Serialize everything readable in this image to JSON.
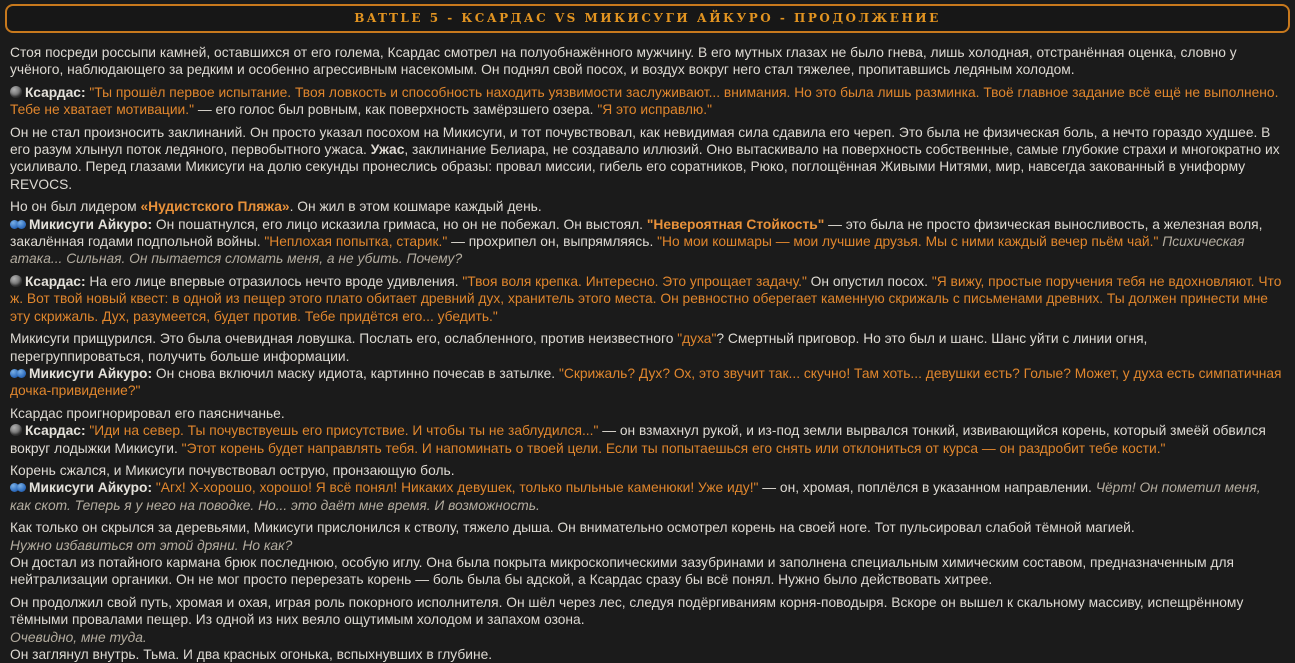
{
  "header": {
    "title": "BATTLE 5 - КСАРДАС VS МИКИСУГИ АЙКУРО - ПРОДОЛЖЕНИЕ"
  },
  "colors": {
    "background": "#1b1b1b",
    "narration_text": "#dedad3",
    "speech_accent": "#e0862d",
    "monologue_gray": "#b3ac9f",
    "header_accent": "#e29421",
    "header_border": "#c8791d",
    "mikisugi_icon_blue": "#3270c0",
    "ksardas_icon_gray": "#8a8a8a"
  },
  "characters": [
    {
      "name": "Ксардас",
      "icon": "dark-orb-icon"
    },
    {
      "name": "Микисуги Айкуро",
      "icon": "blue-glasses-icon"
    }
  ],
  "story": {
    "blocks": [
      {
        "lines": [
          [
            {
              "style": "narration",
              "text": "Стоя посреди россыпи камней, оставшихся от его голема, Ксардас смотрел на полуобнажённого мужчину. В его мутных глазах не было гнева, лишь холодная, отстранённая оценка, словно у учёного, наблюдающего за редким и особенно агрессивным насекомым. Он поднял свой посох, и воздух вокруг него стал тяжелее, пропитавшись ледяным холодом."
            }
          ]
        ]
      },
      {
        "lines": [
          [
            {
              "icon": "ksardas"
            },
            {
              "style": "name",
              "text": "Ксардас: "
            },
            {
              "style": "speech",
              "text": "\"Ты прошёл первое испытание. Твоя ловкость и способность находить уязвимости заслуживают... внимания. Но это была лишь разминка. Твоё главное задание всё ещё не выполнено. Тебе не хватает мотивации.\""
            },
            {
              "style": "narration",
              "text": " — его голос был ровным, как поверхность замёрзшего озера. "
            },
            {
              "style": "speech",
              "text": "\"Я это исправлю.\""
            }
          ]
        ]
      },
      {
        "lines": [
          [
            {
              "style": "narration",
              "text": "Он не стал произносить заклинаний. Он просто указал посохом на Микисуги, и тот почувствовал, как невидимая сила сдавила его череп. Это была не физическая боль, а нечто гораздо худшее. В его разум хлынул поток ледяного, первобытного ужаса. "
            },
            {
              "style": "bold",
              "text": "Ужас"
            },
            {
              "style": "narration",
              "text": ", заклинание Белиара, не создавало иллюзий. Оно вытаскивало на поверхность собственные, самые глубокие страхи и многократно их усиливало. Перед глазами Микисуги на долю секунды пронеслись образы: провал миссии, гибель его соратников, Рюко, поглощённая Живыми Нитями, мир, навсегда закованный в униформу REVOCS."
            }
          ]
        ]
      },
      {
        "lines": [
          [
            {
              "style": "narration",
              "text": "Но он был лидером "
            },
            {
              "style": "speech-bold",
              "text": "«Нудистского Пляжа»"
            },
            {
              "style": "narration",
              "text": ". Он жил в этом кошмаре каждый день."
            }
          ],
          [
            {
              "icon": "mikisugi"
            },
            {
              "style": "name",
              "text": "Микисуги Айкуро: "
            },
            {
              "style": "narration",
              "text": "Он пошатнулся, его лицо исказила гримаса, но он не побежал. Он выстоял. "
            },
            {
              "style": "speech-bold",
              "text": "\"Невероятная Стойкость\""
            },
            {
              "style": "narration",
              "text": " — это была не просто физическая выносливость, а железная воля, закалённая годами подпольной войны. "
            },
            {
              "style": "speech",
              "text": "\"Неплохая попытка, старик.\""
            },
            {
              "style": "narration",
              "text": " — прохрипел он, выпрямляясь. "
            },
            {
              "style": "speech",
              "text": "\"Но мои кошмары — мои лучшие друзья. Мы с ними каждый вечер пьём чай.\""
            },
            {
              "style": "monologue",
              "text": " Психическая атака... Сильная. Он пытается сломать меня, а не убить. Почему?"
            }
          ]
        ]
      },
      {
        "lines": [
          [
            {
              "icon": "ksardas"
            },
            {
              "style": "name",
              "text": "Ксардас: "
            },
            {
              "style": "narration",
              "text": "На его лице впервые отразилось нечто вроде удивления. "
            },
            {
              "style": "speech",
              "text": "\"Твоя воля крепка. Интересно. Это упрощает задачу.\""
            },
            {
              "style": "narration",
              "text": " Он опустил посох. "
            },
            {
              "style": "speech",
              "text": "\"Я вижу, простые поручения тебя не вдохновляют. Что ж. Вот твой новый квест: в одной из пещер этого плато обитает древний дух, хранитель этого места. Он ревностно оберегает каменную скрижаль с письменами древних. Ты должен принести мне эту скрижаль. Дух, разумеется, будет против. Тебе придётся его... убедить.\""
            }
          ]
        ]
      },
      {
        "lines": [
          [
            {
              "style": "narration",
              "text": "Микисуги прищурился. Это была очевидная ловушка. Послать его, ослабленного, против неизвестного "
            },
            {
              "style": "speech",
              "text": "\"духа\""
            },
            {
              "style": "narration",
              "text": "? Смертный приговор. Но это был и шанс. Шанс уйти с линии огня, перегруппироваться, получить больше информации."
            }
          ],
          [
            {
              "icon": "mikisugi"
            },
            {
              "style": "name",
              "text": "Микисуги Айкуро: "
            },
            {
              "style": "narration",
              "text": "Он снова включил маску идиота, картинно почесав в затылке. "
            },
            {
              "style": "speech",
              "text": "\"Скрижаль? Дух? Ох, это звучит так... скучно! Там хоть... девушки есть? Голые? Может, у духа есть симпатичная дочка-привидение?\""
            }
          ]
        ]
      },
      {
        "lines": [
          [
            {
              "style": "narration",
              "text": "Ксардас проигнорировал его паясничанье."
            }
          ],
          [
            {
              "icon": "ksardas"
            },
            {
              "style": "name",
              "text": "Ксардас: "
            },
            {
              "style": "speech",
              "text": "\"Иди на север. Ты почувствуешь его присутствие. И чтобы ты не заблудился...\""
            },
            {
              "style": "narration",
              "text": " — он взмахнул рукой, и из-под земли вырвался тонкий, извивающийся корень, который змеёй обвился вокруг лодыжки Микисуги. "
            },
            {
              "style": "speech",
              "text": "\"Этот корень будет направлять тебя. И напоминать о твоей цели. Если ты попытаешься его снять или отклониться от курса — он раздробит тебе кости.\""
            }
          ]
        ]
      },
      {
        "lines": [
          [
            {
              "style": "narration",
              "text": "Корень сжался, и Микисуги почувствовал острую, пронзающую боль."
            }
          ],
          [
            {
              "icon": "mikisugi"
            },
            {
              "style": "name",
              "text": "Микисуги Айкуро: "
            },
            {
              "style": "speech",
              "text": "\"Агх! Х-хорошо, хорошо! Я всё понял! Никаких девушек, только пыльные каменюки! Уже иду!\""
            },
            {
              "style": "narration",
              "text": " — он, хромая, поплёлся в указанном направлении. "
            },
            {
              "style": "monologue",
              "text": "Чёрт! Он пометил меня, как скот. Теперь я у него на поводке. Но... это даёт мне время. И возможность."
            }
          ]
        ]
      },
      {
        "lines": [
          [
            {
              "style": "narration",
              "text": "Как только он скрылся за деревьями, Микисуги прислонился к стволу, тяжело дыша. Он внимательно осмотрел корень на своей ноге. Тот пульсировал слабой тёмной магией."
            }
          ],
          [
            {
              "style": "monologue",
              "text": "Нужно избавиться от этой дряни. Но как?"
            }
          ],
          [
            {
              "style": "narration",
              "text": "Он достал из потайного кармана брюк последнюю, особую иглу. Она была покрыта микроскопическими зазубринами и заполнена специальным химическим составом, предназначенным для нейтрализации органики. Он не мог просто перерезать корень — боль была бы адской, а Ксардас сразу бы всё понял. Нужно было действовать хитрее."
            }
          ]
        ]
      },
      {
        "lines": [
          [
            {
              "style": "narration",
              "text": "Он продолжил свой путь, хромая и охая, играя роль покорного исполнителя. Он шёл через лес, следуя подёргиваниям корня-поводыря. Вскоре он вышел к скальному массиву, испещрённому тёмными провалами пещер. Из одной из них веяло ощутимым холодом и запахом озона."
            }
          ],
          [
            {
              "style": "monologue",
              "text": "Очевидно, мне туда."
            }
          ],
          [
            {
              "style": "narration",
              "text": "Он заглянул внутрь. Тьма. И два красных огонька, вспыхнувших в глубине."
            }
          ]
        ]
      }
    ]
  }
}
